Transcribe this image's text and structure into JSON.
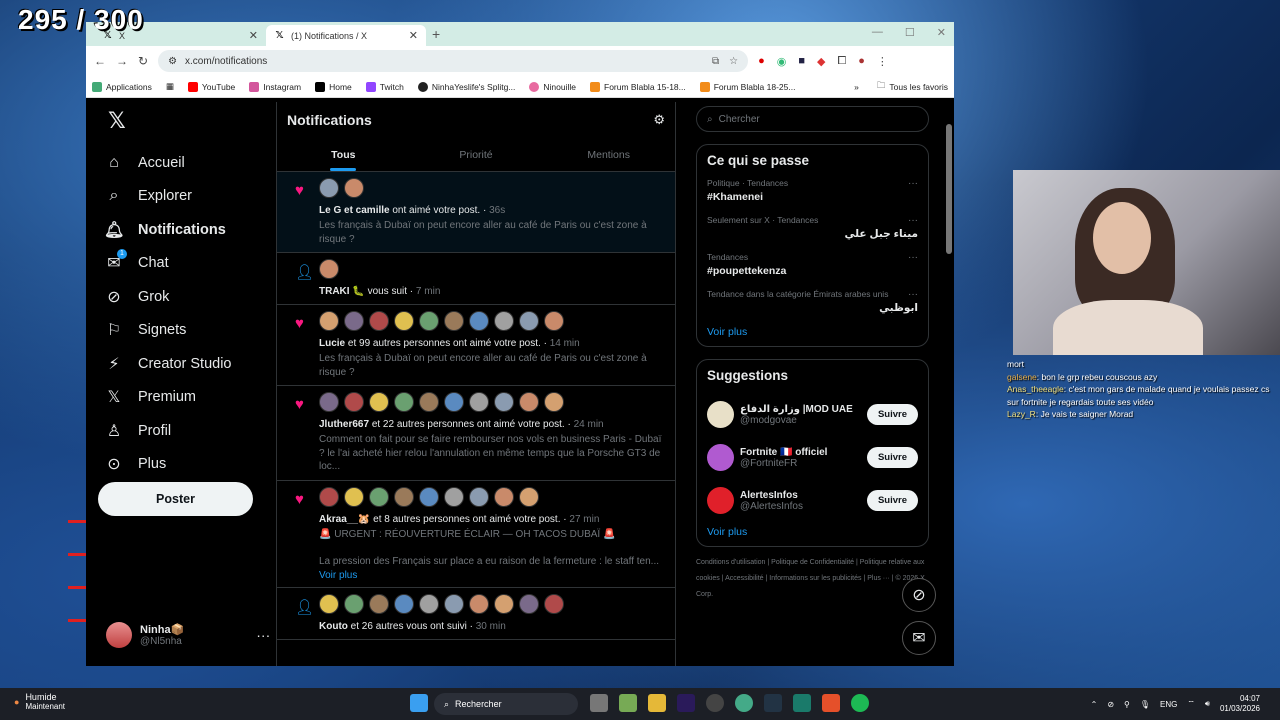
{
  "overlay": {
    "counter": "295 / 300"
  },
  "browser": {
    "tabs": [
      {
        "title": "X"
      },
      {
        "title": "(1) Notifications / X"
      }
    ],
    "url": "x.com/notifications",
    "bookmarks": [
      "Applications",
      "YouTube",
      "Instagram",
      "Home",
      "Twitch",
      "NinhaYeslife's Splitg...",
      "Ninouille",
      "Forum Blabla 15-18...",
      "Forum Blabla 18-25..."
    ],
    "all_bookmarks": "Tous les favoris"
  },
  "nav": {
    "items": [
      {
        "label": "Accueil",
        "icon": "home-icon"
      },
      {
        "label": "Explorer",
        "icon": "search-icon"
      },
      {
        "label": "Notifications",
        "icon": "bell-icon"
      },
      {
        "label": "Chat",
        "icon": "mail-icon",
        "badge": "1"
      },
      {
        "label": "Grok",
        "icon": "grok-icon"
      },
      {
        "label": "Signets",
        "icon": "bookmark-icon"
      },
      {
        "label": "Creator Studio",
        "icon": "creator-icon"
      },
      {
        "label": "Premium",
        "icon": "x-icon"
      },
      {
        "label": "Profil",
        "icon": "person-icon"
      },
      {
        "label": "Plus",
        "icon": "more-icon"
      }
    ],
    "post_button": "Poster",
    "account": {
      "name": "Ninha📦",
      "handle": "@Nl5nha"
    }
  },
  "main": {
    "title": "Notifications",
    "tabs": [
      "Tous",
      "Priorité",
      "Mentions"
    ],
    "notifications": [
      {
        "type": "like",
        "users": "Le G et camille",
        "action": "ont aimé votre post.",
        "time": "36s",
        "snippet": "Les français à Dubaï on peut encore aller au café de Paris ou c'est zone à risque ?",
        "avatars": 2
      },
      {
        "type": "follow",
        "users": "TRAKI 🐛",
        "action": "vous suit",
        "time": "7 min",
        "snippet": "",
        "avatars": 1
      },
      {
        "type": "like",
        "users": "Lucie",
        "action": "et 99 autres personnes ont aimé votre post.",
        "time": "14 min",
        "snippet": "Les français à Dubaï on peut encore aller au café de Paris ou c'est zone à risque ?",
        "avatars": 10
      },
      {
        "type": "like",
        "users": "Jluther667",
        "action": "et 22 autres personnes ont aimé votre post.",
        "time": "24 min",
        "snippet": "Comment on fait pour se faire rembourser nos vols en business Paris - Dubaï ? le l'ai acheté hier relou l'annulation en même temps que la Porsche GT3 de loc...",
        "avatars": 10
      },
      {
        "type": "like",
        "users": "Akraa__🐹",
        "action": "et 8 autres personnes ont aimé votre post.",
        "time": "27 min",
        "snippet": "🚨 URGENT : RÉOUVERTURE ÉCLAIR — OH TACOS DUBAÏ 🚨\n\nLa pression des Français sur place a eu raison de la fermeture : le staff ten...",
        "more": "Voir plus",
        "avatars": 9
      },
      {
        "type": "follow",
        "users": "Kouto",
        "action": "et 26 autres vous ont suivi",
        "time": "30 min",
        "snippet": "",
        "avatars": 10
      }
    ]
  },
  "right": {
    "search_placeholder": "Chercher",
    "trends_title": "Ce qui se passe",
    "trends": [
      {
        "context": "Politique · Tendances",
        "topic": "#Khamenei"
      },
      {
        "context": "Seulement sur X · Tendances",
        "topic": "ميناء جبل علي"
      },
      {
        "context": "Tendances",
        "topic": "#poupettekenza"
      },
      {
        "context": "Tendance dans la catégorie Émirats arabes unis",
        "topic": "ابوظبي"
      }
    ],
    "see_more": "Voir plus",
    "suggestions_title": "Suggestions",
    "suggestions": [
      {
        "name": "وزارة الدفاع |MOD UAE",
        "handle": "@modgovae",
        "color": "#e8e0c8"
      },
      {
        "name": "Fortnite 🇫🇷 officiel",
        "handle": "@FortniteFR",
        "color": "#b05ad0"
      },
      {
        "name": "AlertesInfos",
        "handle": "@AlertesInfos",
        "color": "#e0202a"
      }
    ],
    "follow_label": "Suivre",
    "footer": [
      "Conditions d'utilisation",
      "Politique de Confidentialité",
      "Politique relative aux cookies",
      "Accessibilité",
      "Informations sur les publicités",
      "Plus ···",
      "© 2026 X Corp."
    ]
  },
  "chat": [
    {
      "user": "galsene",
      "msg": "bon le grp rebeu couscous azy"
    },
    {
      "user": "Anas_theeagle",
      "msg": "c'est mon gars de malade quand je voulais passez cs sur fortnite je regardais toute ses vidéo"
    },
    {
      "user": "Lazy_R",
      "msg": "Je vais te saigner Morad"
    }
  ],
  "chat_top": "mort",
  "taskbar": {
    "weather": "Humide",
    "weather_sub": "Maintenant",
    "search": "Rechercher",
    "lang": "ENG",
    "time": "04:07",
    "date": "01/03/2026"
  }
}
